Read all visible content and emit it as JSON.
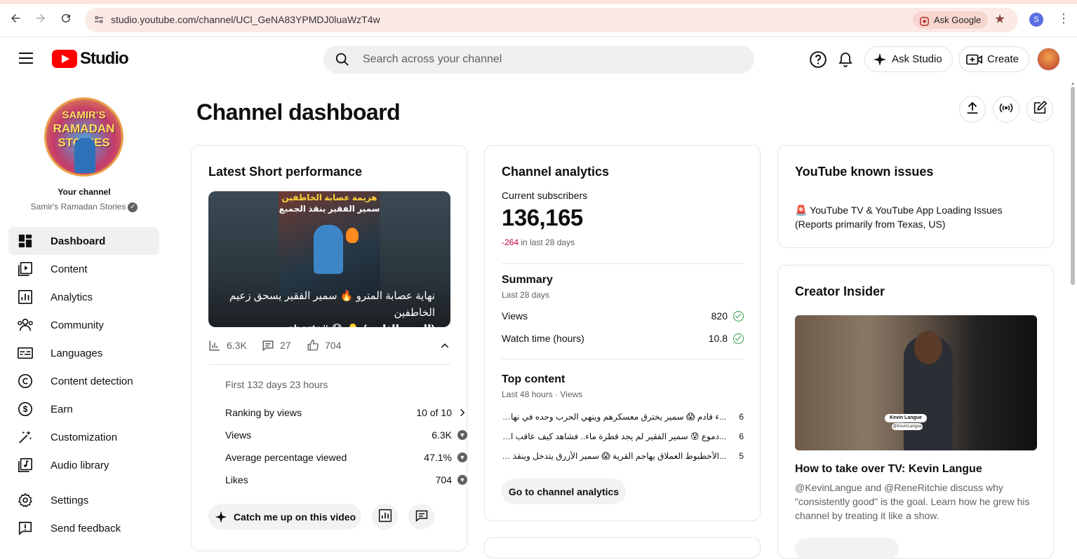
{
  "browser": {
    "url": "studio.youtube.com/channel/UCl_GeNA83YPMDJ0luaWzT4w",
    "ask_google": "Ask Google",
    "profile_initial": "S"
  },
  "header": {
    "logo_text": "Studio",
    "search_placeholder": "Search across your channel",
    "ask_studio": "Ask Studio",
    "create": "Create"
  },
  "sidebar": {
    "your_channel": "Your channel",
    "channel_name": "Samir's Ramadan Stories",
    "avatar_text_1": "SAMIR'S",
    "avatar_text_2": "RAMADAN STORIES",
    "items": [
      {
        "label": "Dashboard",
        "icon": "dashboard-icon",
        "active": true
      },
      {
        "label": "Content",
        "icon": "content-icon"
      },
      {
        "label": "Analytics",
        "icon": "analytics-icon"
      },
      {
        "label": "Community",
        "icon": "community-icon"
      },
      {
        "label": "Languages",
        "icon": "languages-icon"
      },
      {
        "label": "Content detection",
        "icon": "copyright-icon"
      },
      {
        "label": "Earn",
        "icon": "dollar-icon"
      },
      {
        "label": "Customization",
        "icon": "magic-wand-icon"
      },
      {
        "label": "Audio library",
        "icon": "audio-library-icon"
      },
      {
        "label": "Settings",
        "icon": "gear-icon"
      },
      {
        "label": "Send feedback",
        "icon": "feedback-icon"
      }
    ]
  },
  "page": {
    "title": "Channel dashboard"
  },
  "latest_short": {
    "title": "Latest Short performance",
    "thumb_overlay_1": "هزيمة عصابة الخاطفين",
    "thumb_overlay_2": "سمير الفقير ينقذ الجميع",
    "caption_line1": "نهاية عصابة المترو 🔥 سمير الفقير يسحق زعيم الخاطفين",
    "caption_line2": "(الجزء الثاني) 🧑‍🦲 😱 #shorts #arabicstories",
    "views": "6.3K",
    "comments": "27",
    "likes": "704",
    "period": "First 132 days 23 hours",
    "rows": [
      {
        "label": "Ranking by views",
        "value": "10 of 10"
      },
      {
        "label": "Views",
        "value": "6.3K"
      },
      {
        "label": "Average percentage viewed",
        "value": "47.1%"
      },
      {
        "label": "Likes",
        "value": "704"
      }
    ],
    "catch_me_up": "Catch me up on this video"
  },
  "analytics": {
    "title": "Channel analytics",
    "subs_label": "Current subscribers",
    "subs_value": "136,165",
    "subs_change": "-264",
    "subs_change_suffix": " in last 28 days",
    "summary_title": "Summary",
    "summary_period": "Last 28 days",
    "summary_rows": [
      {
        "label": "Views",
        "value": "820"
      },
      {
        "label": "Watch time (hours)",
        "value": "10.8"
      }
    ],
    "top_title": "Top content",
    "top_period": "Last 48 hours · Views",
    "top_rows": [
      {
        "title": "...ء قادم 😱 سمير يخترق معسكرهم وينهي الحرب وحده في نهار رمضان",
        "value": "6"
      },
      {
        "title": "...دموع 😰 سمير الفقير لم يجد قطرة ماء.. فشاهد كيف عاقب الغني المتكبر",
        "value": "6"
      },
      {
        "title": "...الأخطبوط العملاق يهاجم القرية 😱 سمير الأزرق يتدخل وينقذ الجميع",
        "value": "5"
      }
    ],
    "go_button": "Go to channel analytics"
  },
  "known_issues": {
    "title": "YouTube known issues",
    "text": "🚨 YouTube TV & YouTube App Loading Issues (Reports primarily from Texas, US)"
  },
  "creator_insider": {
    "title": "Creator Insider",
    "video_title": "How to take over TV: Kevin Langue",
    "description": "@KevinLangue and @ReneRitchie discuss why \"consistently good\" is the goal. Learn how he grew his channel by treating it like a show.",
    "tag_name": "Kevin Langue",
    "tag_handle": "@KevinLangue"
  },
  "colors": {
    "accent_red": "#ff0000",
    "negative": "#c00046",
    "check_green": "#2e9e49"
  }
}
